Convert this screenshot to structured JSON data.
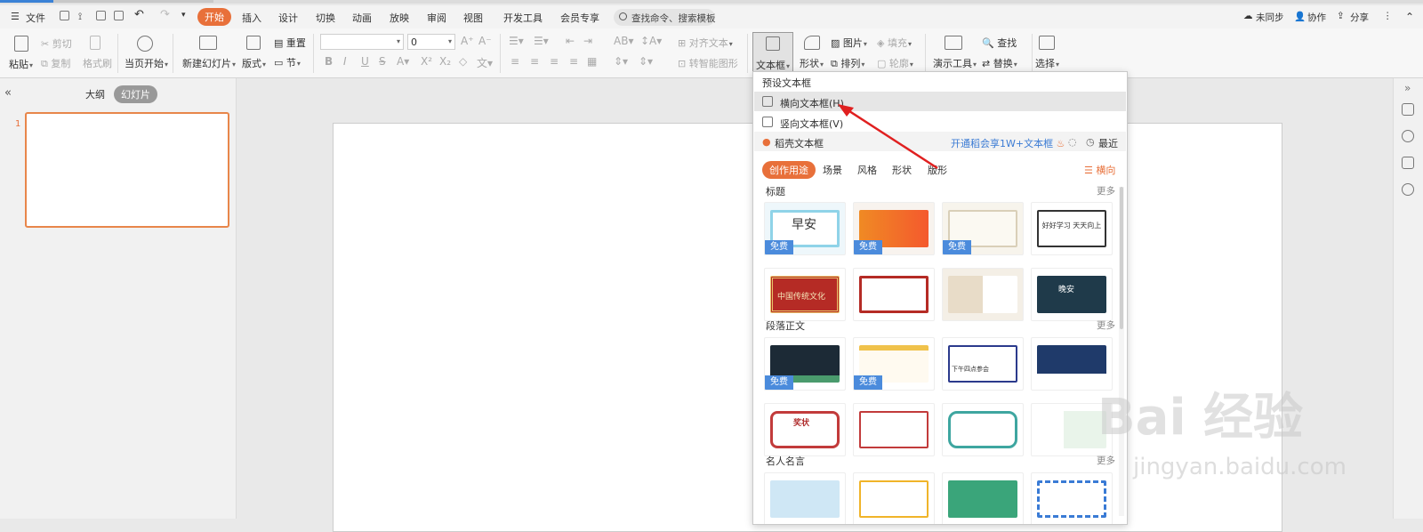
{
  "menubar": {
    "file": "文件",
    "tabs": [
      "开始",
      "插入",
      "设计",
      "切换",
      "动画",
      "放映",
      "审阅",
      "视图",
      "开发工具",
      "会员专享"
    ],
    "search_placeholder": "查找命令、搜索模板",
    "not_synced": "未同步",
    "collab": "协作",
    "share": "分享"
  },
  "ribbon": {
    "paste": "粘贴",
    "cut": "剪切",
    "copy": "复制",
    "format_painter": "格式刷",
    "from_current": "当页开始",
    "new_slide": "新建幻灯片",
    "layout": "版式",
    "reset": "重置",
    "section": "节",
    "font_size": "0",
    "align_text": "对齐文本",
    "smart_art": "转智能图形",
    "text_box": "文本框",
    "shape": "形状",
    "picture": "图片",
    "fill": "填充",
    "arrange": "排列",
    "outline": "轮廓",
    "present_tools": "演示工具",
    "find": "查找",
    "replace": "替换",
    "select": "选择"
  },
  "left_pane": {
    "outline_tab": "大纲",
    "slides_tab": "幻灯片",
    "slide_number": "1"
  },
  "dropdown": {
    "preset_header": "预设文本框",
    "horizontal": "横向文本框(H)",
    "vertical": "竖向文本框(V)",
    "daoke": "稻壳文本框",
    "promo": "开通稻会享1W+文本框",
    "recent": "最近",
    "categories": [
      "创作用途",
      "场景",
      "风格",
      "形状",
      "版形"
    ],
    "orientation": "横向",
    "sections": [
      {
        "title": "标题",
        "more": "更多"
      },
      {
        "title": "段落正文",
        "more": "更多"
      },
      {
        "title": "名人名言",
        "more": "更多"
      }
    ],
    "free_badge": "免费",
    "thumb_texts": [
      "早安",
      "好好学习 天天向上",
      "中国传统文化",
      "晚安",
      "奖状",
      "下午四点参会"
    ]
  },
  "watermark": {
    "brand": "Bai  经验",
    "url": "jingyan.baidu.com"
  },
  "colors": {
    "accent": "#e8703a",
    "badge_blue": "#4b8bdc",
    "arrow_red": "#e02020"
  }
}
